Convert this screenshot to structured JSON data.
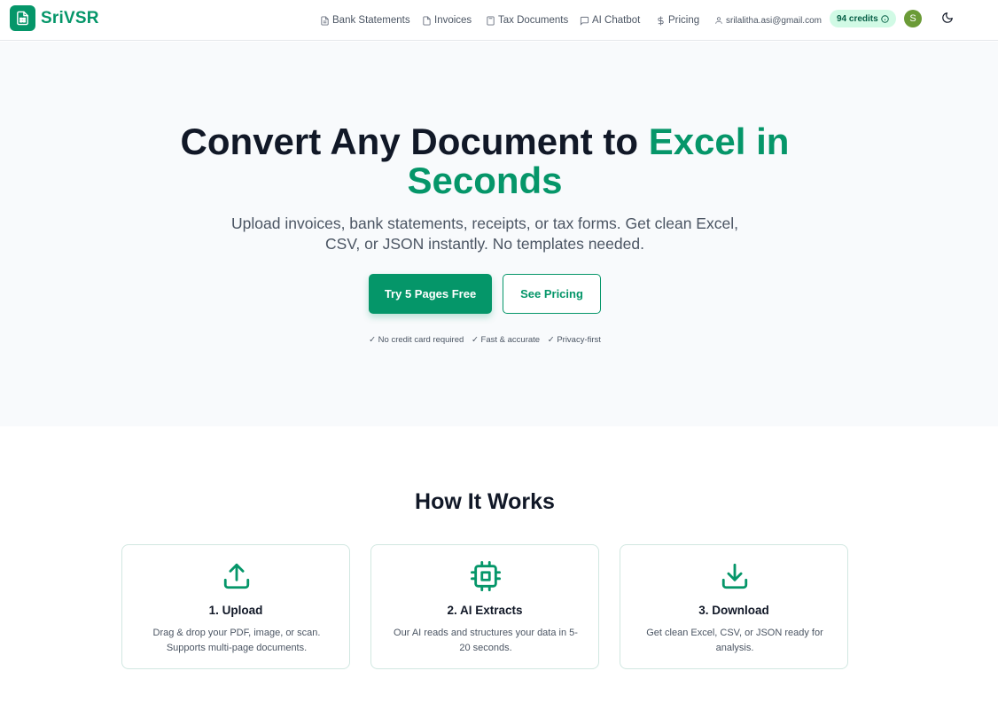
{
  "brand": {
    "name": "SriVSR",
    "color": "#059669"
  },
  "nav": {
    "items": [
      {
        "label": "Bank Statements",
        "icon": "file-text-icon"
      },
      {
        "label": "Invoices",
        "icon": "file-icon"
      },
      {
        "label": "Tax Documents",
        "icon": "calculator-icon"
      },
      {
        "label": "AI Chatbot",
        "icon": "message-icon"
      },
      {
        "label": "Pricing",
        "icon": "dollar-icon"
      }
    ],
    "user_email": "srilalitha.asi@gmail.com",
    "credits": "94 credits",
    "avatar_initial": "S"
  },
  "hero": {
    "title_main": "Convert Any Document to ",
    "title_accent_1": "Excel in",
    "title_accent_2": "Seconds",
    "subtitle_line1": "Upload invoices, bank statements, receipts, or tax forms. Get clean Excel,",
    "subtitle_line2": "CSV, or JSON instantly. No templates needed.",
    "primary_button": "Try 5 Pages Free",
    "secondary_button": "See Pricing",
    "trust": [
      "✓ No credit card required",
      "✓ Fast & accurate",
      "✓ Privacy-first"
    ]
  },
  "how": {
    "title": "How It Works",
    "steps": [
      {
        "title": "1. Upload",
        "desc": "Drag & drop your PDF, image, or scan. Supports multi-page documents.",
        "icon": "upload-icon"
      },
      {
        "title": "2. AI Extracts",
        "desc": "Our AI reads and structures your data in 5-20 seconds.",
        "icon": "cpu-icon"
      },
      {
        "title": "3. Download",
        "desc": "Get clean Excel, CSV, or JSON ready for analysis.",
        "icon": "download-icon"
      }
    ]
  }
}
